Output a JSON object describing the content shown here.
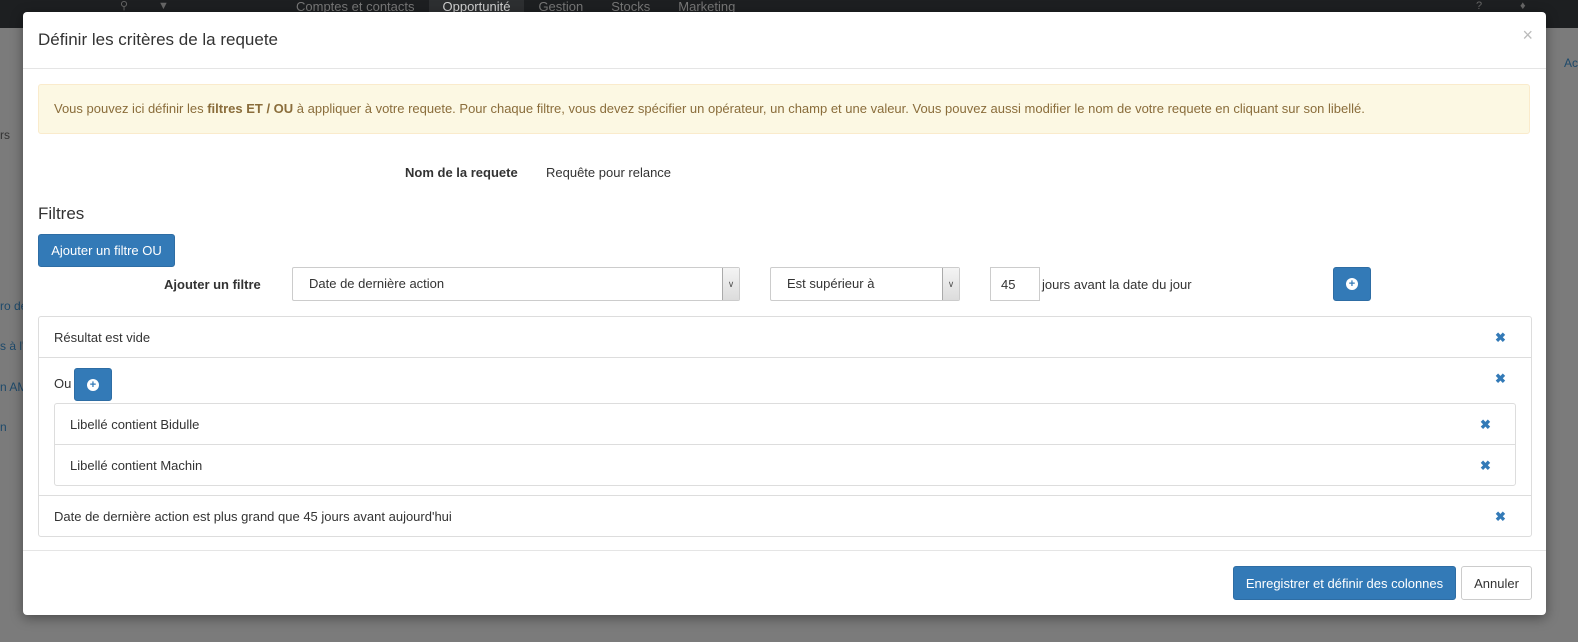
{
  "background": {
    "nav": [
      "Comptes et contacts",
      "Opportunité",
      "Gestion",
      "Stocks",
      "Marketing"
    ],
    "active_nav": "Opportunité",
    "left_fragments": [
      "rs",
      "ro de",
      "s à l'",
      "n AM",
      "n"
    ],
    "right_fragment": "Ac"
  },
  "modal": {
    "title": "Définir les critères de la requete",
    "close": "×",
    "alert": {
      "before": "Vous pouvez ici définir les ",
      "bold": "filtres ET / OU",
      "after": " à appliquer à votre requete. Pour chaque filtre, vous devez spécifier un opérateur, un champ et une valeur. Vous pouvez aussi modifier le nom de votre requete en cliquant sur son libellé."
    },
    "query_name_label": "Nom de la requete",
    "query_name_value": "Requête pour relance",
    "filters_title": "Filtres",
    "add_or_button": "Ajouter un filtre OU",
    "add_filter": {
      "label": "Ajouter un filtre",
      "field_value": "Date de dernière action",
      "operator_value": "Est supérieur à",
      "value": "45",
      "value_suffix": "jours avant la date du jour"
    },
    "filters": {
      "empty_result": "Résultat est vide",
      "or_label": "Ou",
      "or_items": [
        "Libellé contient Bidulle",
        "Libellé contient Machin"
      ],
      "date_filter": "Date de dernière action est plus grand que 45 jours avant aujourd'hui"
    },
    "footer": {
      "save_button": "Enregistrer et définir des colonnes",
      "cancel_button": "Annuler"
    }
  },
  "colors": {
    "primary": "#337ab7",
    "alert_bg": "#fcf8e3",
    "alert_text": "#8a6d3b"
  }
}
